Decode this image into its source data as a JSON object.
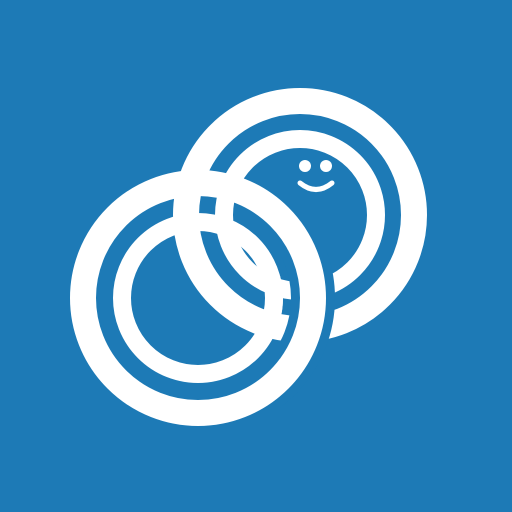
{
  "app_icon": {
    "icon_name": "linked-rings-smiley-icon",
    "background_color": "#1d7ab6",
    "foreground_color": "#ffffff"
  }
}
